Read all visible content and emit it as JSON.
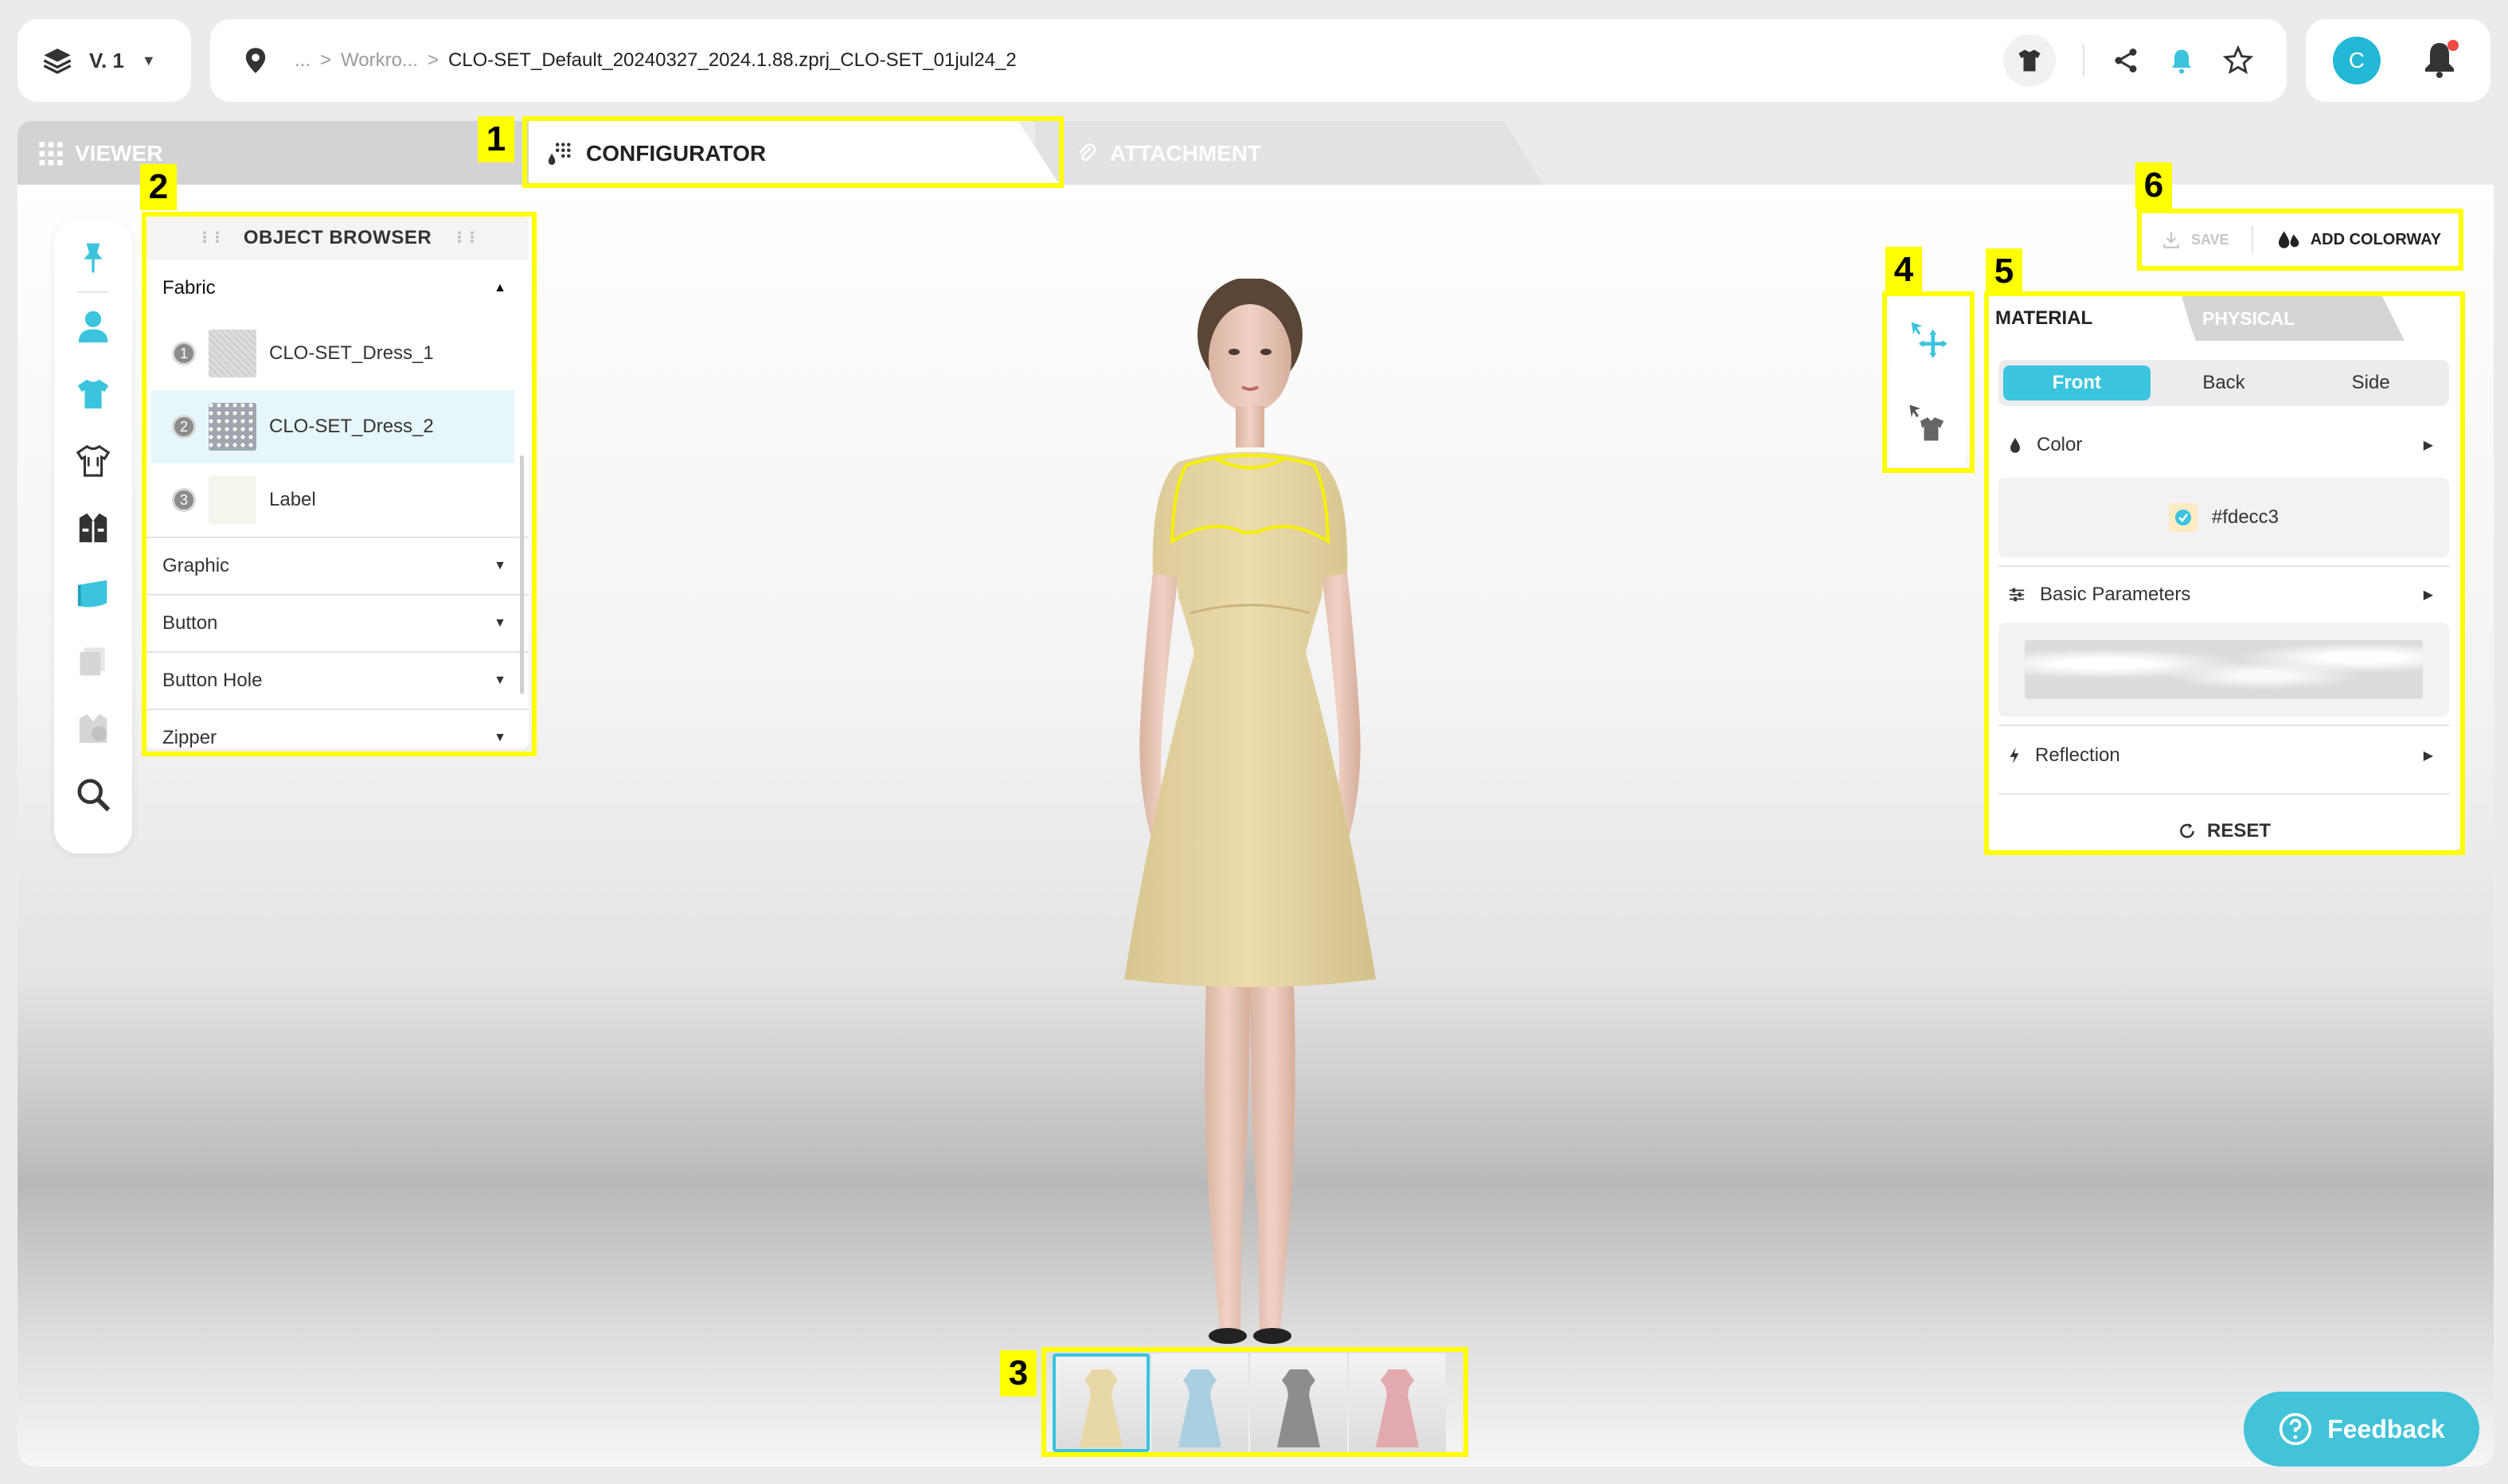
{
  "topbar": {
    "version_label": "V. 1",
    "breadcrumb": {
      "dots": "...",
      "separator": ">",
      "folder": "Workro...",
      "file": "CLO-SET_Default_20240327_2024.1.88.zprj_CLO-SET_01jul24_2"
    },
    "user_initial": "C"
  },
  "tabs": {
    "viewer": "VIEWER",
    "configurator": "CONFIGURATOR",
    "attachment": "ATTACHMENT"
  },
  "object_browser": {
    "title": "OBJECT BROWSER",
    "sections": {
      "fabric": "Fabric",
      "graphic": "Graphic",
      "button": "Button",
      "button_hole": "Button Hole",
      "zipper": "Zipper"
    },
    "fabric_items": [
      {
        "num": "1",
        "name": "CLO-SET_Dress_1"
      },
      {
        "num": "2",
        "name": "CLO-SET_Dress_2"
      },
      {
        "num": "3",
        "name": "Label"
      }
    ]
  },
  "actions": {
    "save": "SAVE",
    "add_colorway": "ADD COLORWAY"
  },
  "material_panel": {
    "tab_material": "MATERIAL",
    "tab_physical": "PHYSICAL",
    "sides": [
      "Front",
      "Back",
      "Side"
    ],
    "color_label": "Color",
    "color_value": "#fdecc3",
    "basic_params_label": "Basic Parameters",
    "reflection_label": "Reflection",
    "reset_label": "RESET"
  },
  "colorways": [
    {
      "color": "#e8d8a8"
    },
    {
      "color": "#a9cfe0"
    },
    {
      "color": "#8d8d8d"
    },
    {
      "color": "#e2a9ae"
    }
  ],
  "feedback_label": "Feedback",
  "annotations": {
    "n1": "1",
    "n2": "2",
    "n3": "3",
    "n4": "4",
    "n5": "5",
    "n6": "6"
  },
  "colors": {
    "accent": "#3cc3dd",
    "highlight": "#ffff00",
    "garment": "#e6d7a6"
  }
}
